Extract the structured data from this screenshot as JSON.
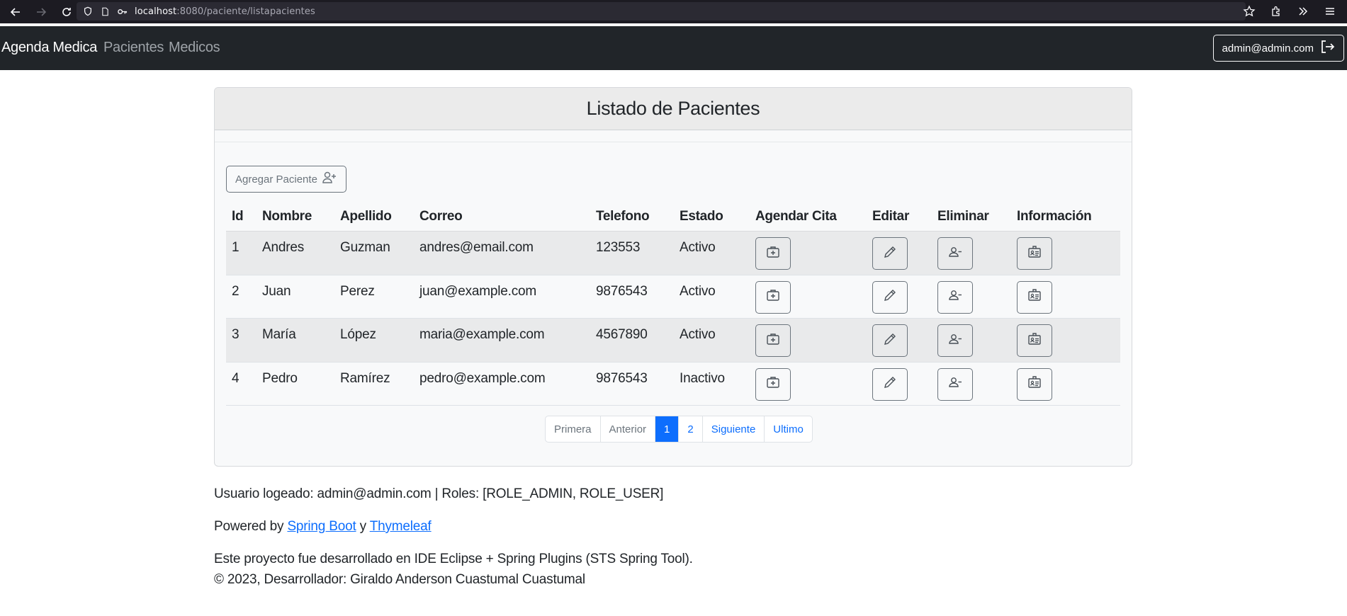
{
  "browser": {
    "url_host": "localhost",
    "url_rest": ":8080/paciente/listapacientes"
  },
  "navbar": {
    "brand": "Agenda Medica",
    "links": [
      "Pacientes",
      "Medicos"
    ],
    "user": "admin@admin.com"
  },
  "card": {
    "title": "Listado de Pacientes",
    "add_button": "Agregar Paciente"
  },
  "table": {
    "headers": [
      "Id",
      "Nombre",
      "Apellido",
      "Correo",
      "Telefono",
      "Estado",
      "Agendar Cita",
      "Editar",
      "Eliminar",
      "Información"
    ],
    "rows": [
      {
        "id": "1",
        "nombre": "Andres",
        "apellido": "Guzman",
        "correo": "andres@email.com",
        "telefono": "123553",
        "estado": "Activo"
      },
      {
        "id": "2",
        "nombre": "Juan",
        "apellido": "Perez",
        "correo": "juan@example.com",
        "telefono": "9876543",
        "estado": "Activo"
      },
      {
        "id": "3",
        "nombre": "María",
        "apellido": "López",
        "correo": "maria@example.com",
        "telefono": "4567890",
        "estado": "Activo"
      },
      {
        "id": "4",
        "nombre": "Pedro",
        "apellido": "Ramírez",
        "correo": "pedro@example.com",
        "telefono": "9876543",
        "estado": "Inactivo"
      }
    ]
  },
  "pagination": {
    "first": "Primera",
    "prev": "Anterior",
    "pages": [
      "1",
      "2"
    ],
    "current": "1",
    "next": "Siguiente",
    "last": "Ultimo"
  },
  "footer": {
    "user_line": "Usuario logeado: admin@admin.com | Roles: [ROLE_ADMIN, ROLE_USER]",
    "powered_prefix": "Powered by",
    "link_spring": "Spring Boot",
    "powered_and": "y",
    "link_thymeleaf": "Thymeleaf",
    "ide_line": "Este proyecto fue desarrollado en IDE Eclipse + Spring Plugins (STS Spring Tool).",
    "copyright": "© 2023, Desarrollador: Giraldo Anderson Cuastumal Cuastumal"
  },
  "colors": {
    "navbar_bg": "#212529",
    "primary": "#0d6efd",
    "secondary": "#6c757d"
  }
}
